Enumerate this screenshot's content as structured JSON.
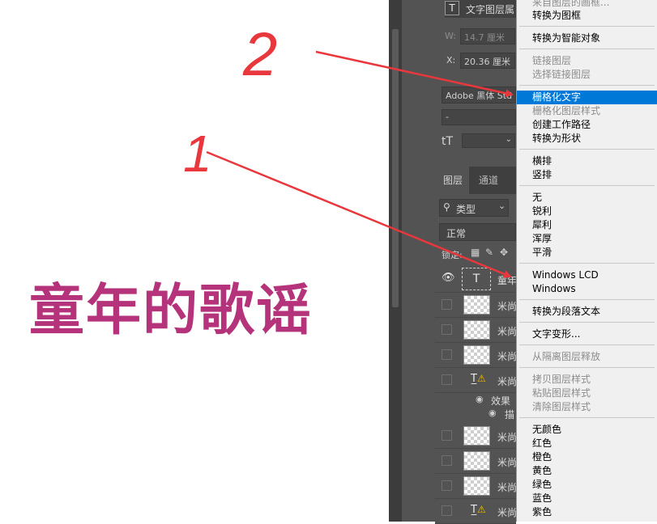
{
  "canvas": {
    "text": "童年的歌谣",
    "annotations": {
      "label_1": "1",
      "label_2": "2"
    }
  },
  "properties": {
    "layer_type_label": "文字图层属",
    "width_label": "W:",
    "width_value": "14.7 厘米",
    "x_label": "X:",
    "x_value": "20.36 厘米",
    "font_family": "Adobe 黑体 Std",
    "font_style": "-",
    "size_icon": "tT"
  },
  "layers_panel": {
    "tabs": [
      "图层",
      "通道"
    ],
    "filter_label": "类型",
    "blend_mode": "正常",
    "lock_label": "锁定:",
    "rows": [
      {
        "name": "童年",
        "type": "text"
      },
      {
        "name": "米尚",
        "type": "image"
      },
      {
        "name": "米尚",
        "type": "image"
      },
      {
        "name": "米尚",
        "type": "image"
      },
      {
        "name": "米尚",
        "type": "warn"
      },
      {
        "name": "效果",
        "type": "effect"
      },
      {
        "name": "描",
        "type": "effect-item"
      },
      {
        "name": "米尚",
        "type": "image"
      },
      {
        "name": "米尚",
        "type": "image"
      },
      {
        "name": "米尚",
        "type": "image"
      },
      {
        "name": "米尚",
        "type": "warn"
      }
    ]
  },
  "context_menu": {
    "items": [
      {
        "label": "来自图层的画框...",
        "disabled": true
      },
      {
        "label": "转换为图框",
        "disabled": false
      },
      {
        "label": "转换为智能对象",
        "disabled": false
      },
      {
        "label": "链接图层",
        "disabled": true
      },
      {
        "label": "选择链接图层",
        "disabled": true
      },
      {
        "label": "栅格化文字",
        "disabled": false,
        "selected": true
      },
      {
        "label": "栅格化图层样式",
        "disabled": true
      },
      {
        "label": "创建工作路径",
        "disabled": false
      },
      {
        "label": "转换为形状",
        "disabled": false
      },
      {
        "label": "横排",
        "disabled": false
      },
      {
        "label": "竖排",
        "disabled": false
      },
      {
        "label": "无",
        "disabled": false
      },
      {
        "label": "锐利",
        "disabled": false
      },
      {
        "label": "犀利",
        "disabled": false
      },
      {
        "label": "浑厚",
        "disabled": false
      },
      {
        "label": "平滑",
        "disabled": false
      },
      {
        "label": "Windows LCD",
        "disabled": false
      },
      {
        "label": "Windows",
        "disabled": false
      },
      {
        "label": "转换为段落文本",
        "disabled": false
      },
      {
        "label": "文字变形...",
        "disabled": false
      },
      {
        "label": "从隔离图层释放",
        "disabled": true
      },
      {
        "label": "拷贝图层样式",
        "disabled": true
      },
      {
        "label": "粘贴图层样式",
        "disabled": true
      },
      {
        "label": "清除图层样式",
        "disabled": true
      },
      {
        "label": "无颜色",
        "disabled": false
      },
      {
        "label": "红色",
        "disabled": false
      },
      {
        "label": "橙色",
        "disabled": false
      },
      {
        "label": "黄色",
        "disabled": false
      },
      {
        "label": "绿色",
        "disabled": false
      },
      {
        "label": "蓝色",
        "disabled": false
      },
      {
        "label": "紫色",
        "disabled": false
      }
    ]
  },
  "colors": {
    "canvas_text": "#b5337a",
    "annotation": "#e8383d",
    "menu_highlight": "#0078d7"
  }
}
